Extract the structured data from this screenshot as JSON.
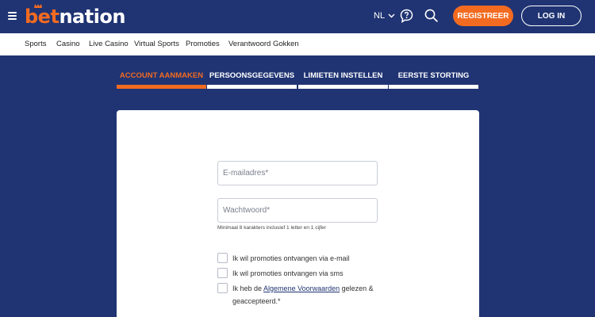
{
  "header": {
    "logo_part1": "bet",
    "logo_part2": "nation",
    "language": "NL",
    "register_label": "REGISTREER",
    "login_label": "LOG IN"
  },
  "nav": {
    "items": [
      "Sports",
      "Casino",
      "Live Casino",
      "Virtual Sports",
      "Promoties",
      "Verantwoord Gokken"
    ]
  },
  "steps": {
    "items": [
      "ACCOUNT AANMAKEN",
      "PERSOONSGEGEVENS",
      "LIMIETEN INSTELLEN",
      "EERSTE STORTING"
    ],
    "active_index": 0
  },
  "form": {
    "email_placeholder": "E-mailadres*",
    "password_placeholder": "Wachtwoord*",
    "password_hint": "Minimaal 8 karakters inclusief 1 letter en 1 cijfer",
    "checkbox_email": "Ik wil promoties ontvangen via e-mail",
    "checkbox_sms": "Ik wil promoties ontvangen via sms",
    "checkbox_terms_prefix": "Ik heb de ",
    "checkbox_terms_link": "Algemene Voorwaarden",
    "checkbox_terms_suffix": " gelezen &",
    "checkbox_terms_line2": "geaccepteerd.*"
  },
  "colors": {
    "brand_navy": "#203473",
    "brand_orange": "#f26b21"
  },
  "icons": {
    "menu": "hamburger-menu-icon",
    "language_chevron": "chevron-down-icon",
    "help": "help-chat-icon",
    "search": "search-icon"
  }
}
